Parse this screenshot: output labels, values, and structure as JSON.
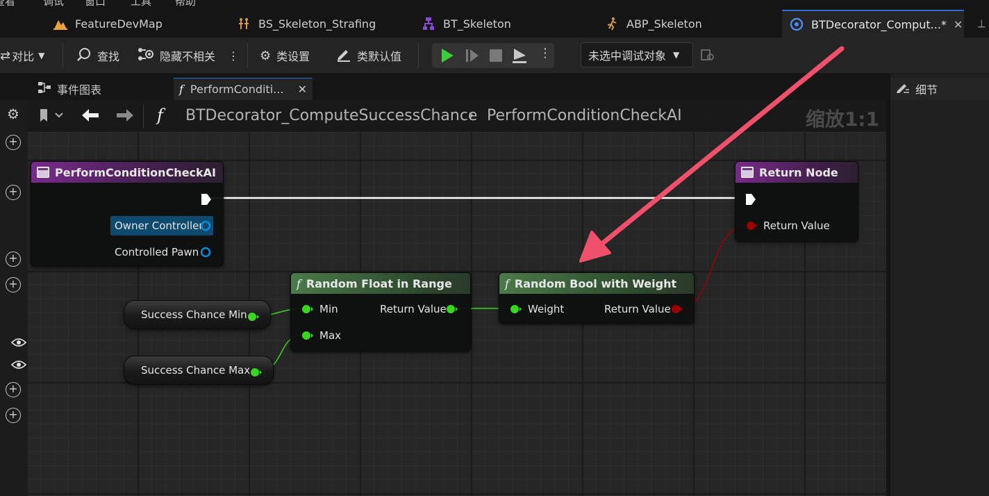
{
  "menu": {
    "items": [
      "查看",
      "调试",
      "窗口",
      "工具",
      "帮助"
    ]
  },
  "asset_tabs": [
    {
      "label": "FeatureDevMap",
      "icon": "map-icon"
    },
    {
      "label": "BS_Skeleton_Strafing",
      "icon": "blendspace-icon"
    },
    {
      "label": "BT_Skeleton",
      "icon": "behavior-tree-icon"
    },
    {
      "label": "ABP_Skeleton",
      "icon": "anim-blueprint-icon"
    },
    {
      "label": "BTDecorator_Comput...*",
      "icon": "blueprint-icon",
      "active": true
    }
  ],
  "toolbar": {
    "diff": "对比",
    "find": "查找",
    "hide_unrelated": "隐藏不相关",
    "class_settings": "类设置",
    "class_defaults": "类默认值",
    "debug_target": "未选中调试对象"
  },
  "doc_tabs": {
    "event_graph": "事件图表",
    "function_tab": "PerformConditi...",
    "details": "细节"
  },
  "breadcrumb": {
    "blueprint": "BTDecorator_ComputeSuccessChance",
    "function": "PerformConditionCheckAI"
  },
  "zoom": "缩放1:1",
  "nodes": {
    "entry": {
      "title": "PerformConditionCheckAI",
      "pin_owner": "Owner Controller",
      "pin_pawn": "Controlled Pawn"
    },
    "return": {
      "title": "Return Node",
      "pin_value": "Return Value"
    },
    "random_float": {
      "title": "Random Float in Range",
      "pin_min": "Min",
      "pin_max": "Max",
      "pin_return": "Return Value"
    },
    "random_bool": {
      "title": "Random Bool with Weight",
      "pin_weight": "Weight",
      "pin_return": "Return Value"
    },
    "var_min": {
      "label": "Success Chance Min"
    },
    "var_max": {
      "label": "Success Chance Max"
    }
  },
  "colors": {
    "exec": "#ffffff",
    "float_pin": "#38d620",
    "bool_pin": "#a00000",
    "object_pin": "#0a8ad8",
    "annotation_arrow": "#f0506a",
    "accent": "#2b6ed6"
  }
}
